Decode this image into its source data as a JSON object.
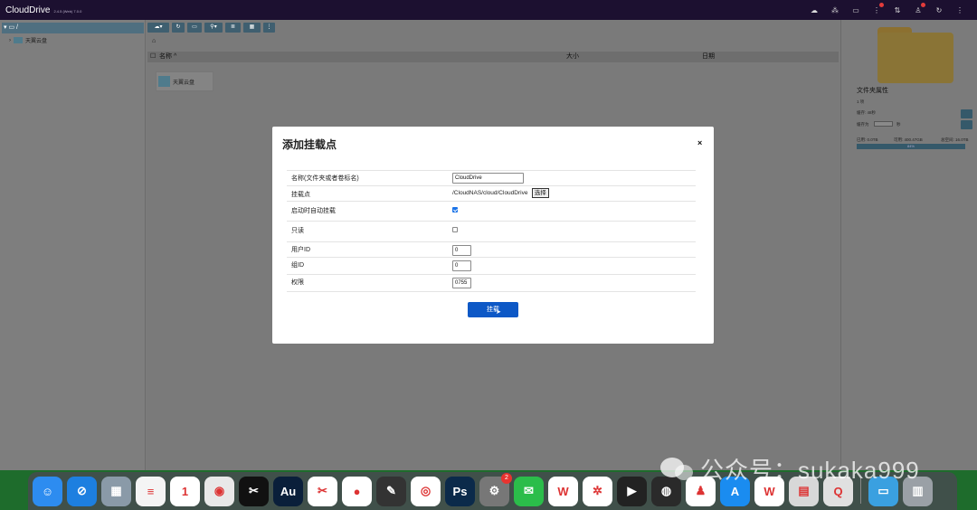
{
  "app": {
    "title": "CloudDrive",
    "version": "2.4.5 (Web) 7.0.0"
  },
  "topbar": {
    "icons": [
      "cloud-icon",
      "network-icon",
      "monitor-icon",
      "tasks-icon",
      "upload-icon",
      "user-icon",
      "refresh-icon",
      "more-icon"
    ]
  },
  "sidebar": {
    "root_label": "/",
    "items": [
      {
        "label": "天翼云盘"
      }
    ]
  },
  "toolbar": {
    "buttons": [
      "cloud-add",
      "refresh",
      "monitor",
      "search",
      "list",
      "grid",
      "more"
    ]
  },
  "table": {
    "columns": {
      "name": "名称 ^",
      "size": "大小",
      "date": "日期"
    }
  },
  "files": [
    {
      "name": "天翼云盘"
    }
  ],
  "right_panel": {
    "title": "文件夹属性",
    "count": "1 项",
    "line1": "缓存: 48秒",
    "line2_label": "缓存为",
    "line2_unit": "秒",
    "storage_used": "已用: 0.0TB",
    "storage_avail": "可用: 400.47GB",
    "storage_total": "总空间: 16.0TB",
    "bar_label": "84%"
  },
  "modal": {
    "title": "添加挂载点",
    "close": "×",
    "rows": {
      "name_label": "名称(文件夹或者卷标名)",
      "name_value": "CloudDrive",
      "mountpoint_label": "挂载点",
      "mountpoint_value": "/CloudNAS/cloud/CloudDrive",
      "select_label": "选择",
      "autostart_label": "启动时自动挂载",
      "autostart_checked": true,
      "readonly_label": "只读",
      "readonly_checked": false,
      "uid_label": "用户ID",
      "uid_value": "0",
      "gid_label": "组ID",
      "gid_value": "0",
      "perm_label": "权限",
      "perm_value": "0755"
    },
    "submit_label": "挂载"
  },
  "dock": {
    "apps": [
      {
        "name": "finder-icon",
        "color": "#2d8cf0",
        "glyph": "☺"
      },
      {
        "name": "safari-icon",
        "color": "#1d7fe0",
        "glyph": "⊘"
      },
      {
        "name": "launchpad-icon",
        "color": "#8a9aa8",
        "glyph": "▦"
      },
      {
        "name": "reminders-icon",
        "color": "#f4f4f4",
        "glyph": "≡"
      },
      {
        "name": "calendar-icon",
        "color": "#ffffff",
        "glyph": "1"
      },
      {
        "name": "chrome-icon",
        "color": "#e8e8e8",
        "glyph": "◉"
      },
      {
        "name": "capcut-icon",
        "color": "#111111",
        "glyph": "✂"
      },
      {
        "name": "audition-icon",
        "color": "#0a1f3a",
        "glyph": "Au"
      },
      {
        "name": "capcut-alt-icon",
        "color": "#ffffff",
        "glyph": "✂"
      },
      {
        "name": "apple-icon",
        "color": "#ffffff",
        "glyph": "●"
      },
      {
        "name": "finalcut-icon",
        "color": "#333333",
        "glyph": "✎"
      },
      {
        "name": "todesk-icon",
        "color": "#ffffff",
        "glyph": "◎"
      },
      {
        "name": "photoshop-icon",
        "color": "#0b2a4a",
        "glyph": "Ps"
      },
      {
        "name": "system-settings-icon",
        "color": "#777777",
        "glyph": "⚙",
        "badge": "2"
      },
      {
        "name": "wechat-icon",
        "color": "#2bbd4a",
        "glyph": "✉"
      },
      {
        "name": "wps-icon",
        "color": "#ffffff",
        "glyph": "W"
      },
      {
        "name": "openai-icon",
        "color": "#ffffff",
        "glyph": "✲"
      },
      {
        "name": "facetime-icon",
        "color": "#222222",
        "glyph": "▶"
      },
      {
        "name": "obs-icon",
        "color": "#2a2a2a",
        "glyph": "◍"
      },
      {
        "name": "qq-icon",
        "color": "#ffffff",
        "glyph": "♟"
      },
      {
        "name": "appstore-icon",
        "color": "#1a8cf0",
        "glyph": "A"
      },
      {
        "name": "wps-doc-icon",
        "color": "#ffffff",
        "glyph": "W"
      },
      {
        "name": "preview-icon",
        "color": "#d8d8d8",
        "glyph": "▤"
      },
      {
        "name": "quicktime-icon",
        "color": "#e0e0e0",
        "glyph": "Q"
      }
    ],
    "trailing": [
      {
        "name": "folder-icon",
        "color": "#3aa0e0",
        "glyph": "▭"
      },
      {
        "name": "trash-icon",
        "color": "#9aa0a6",
        "glyph": "▥"
      }
    ]
  },
  "watermark": {
    "text": "公众号：sukaka999"
  }
}
